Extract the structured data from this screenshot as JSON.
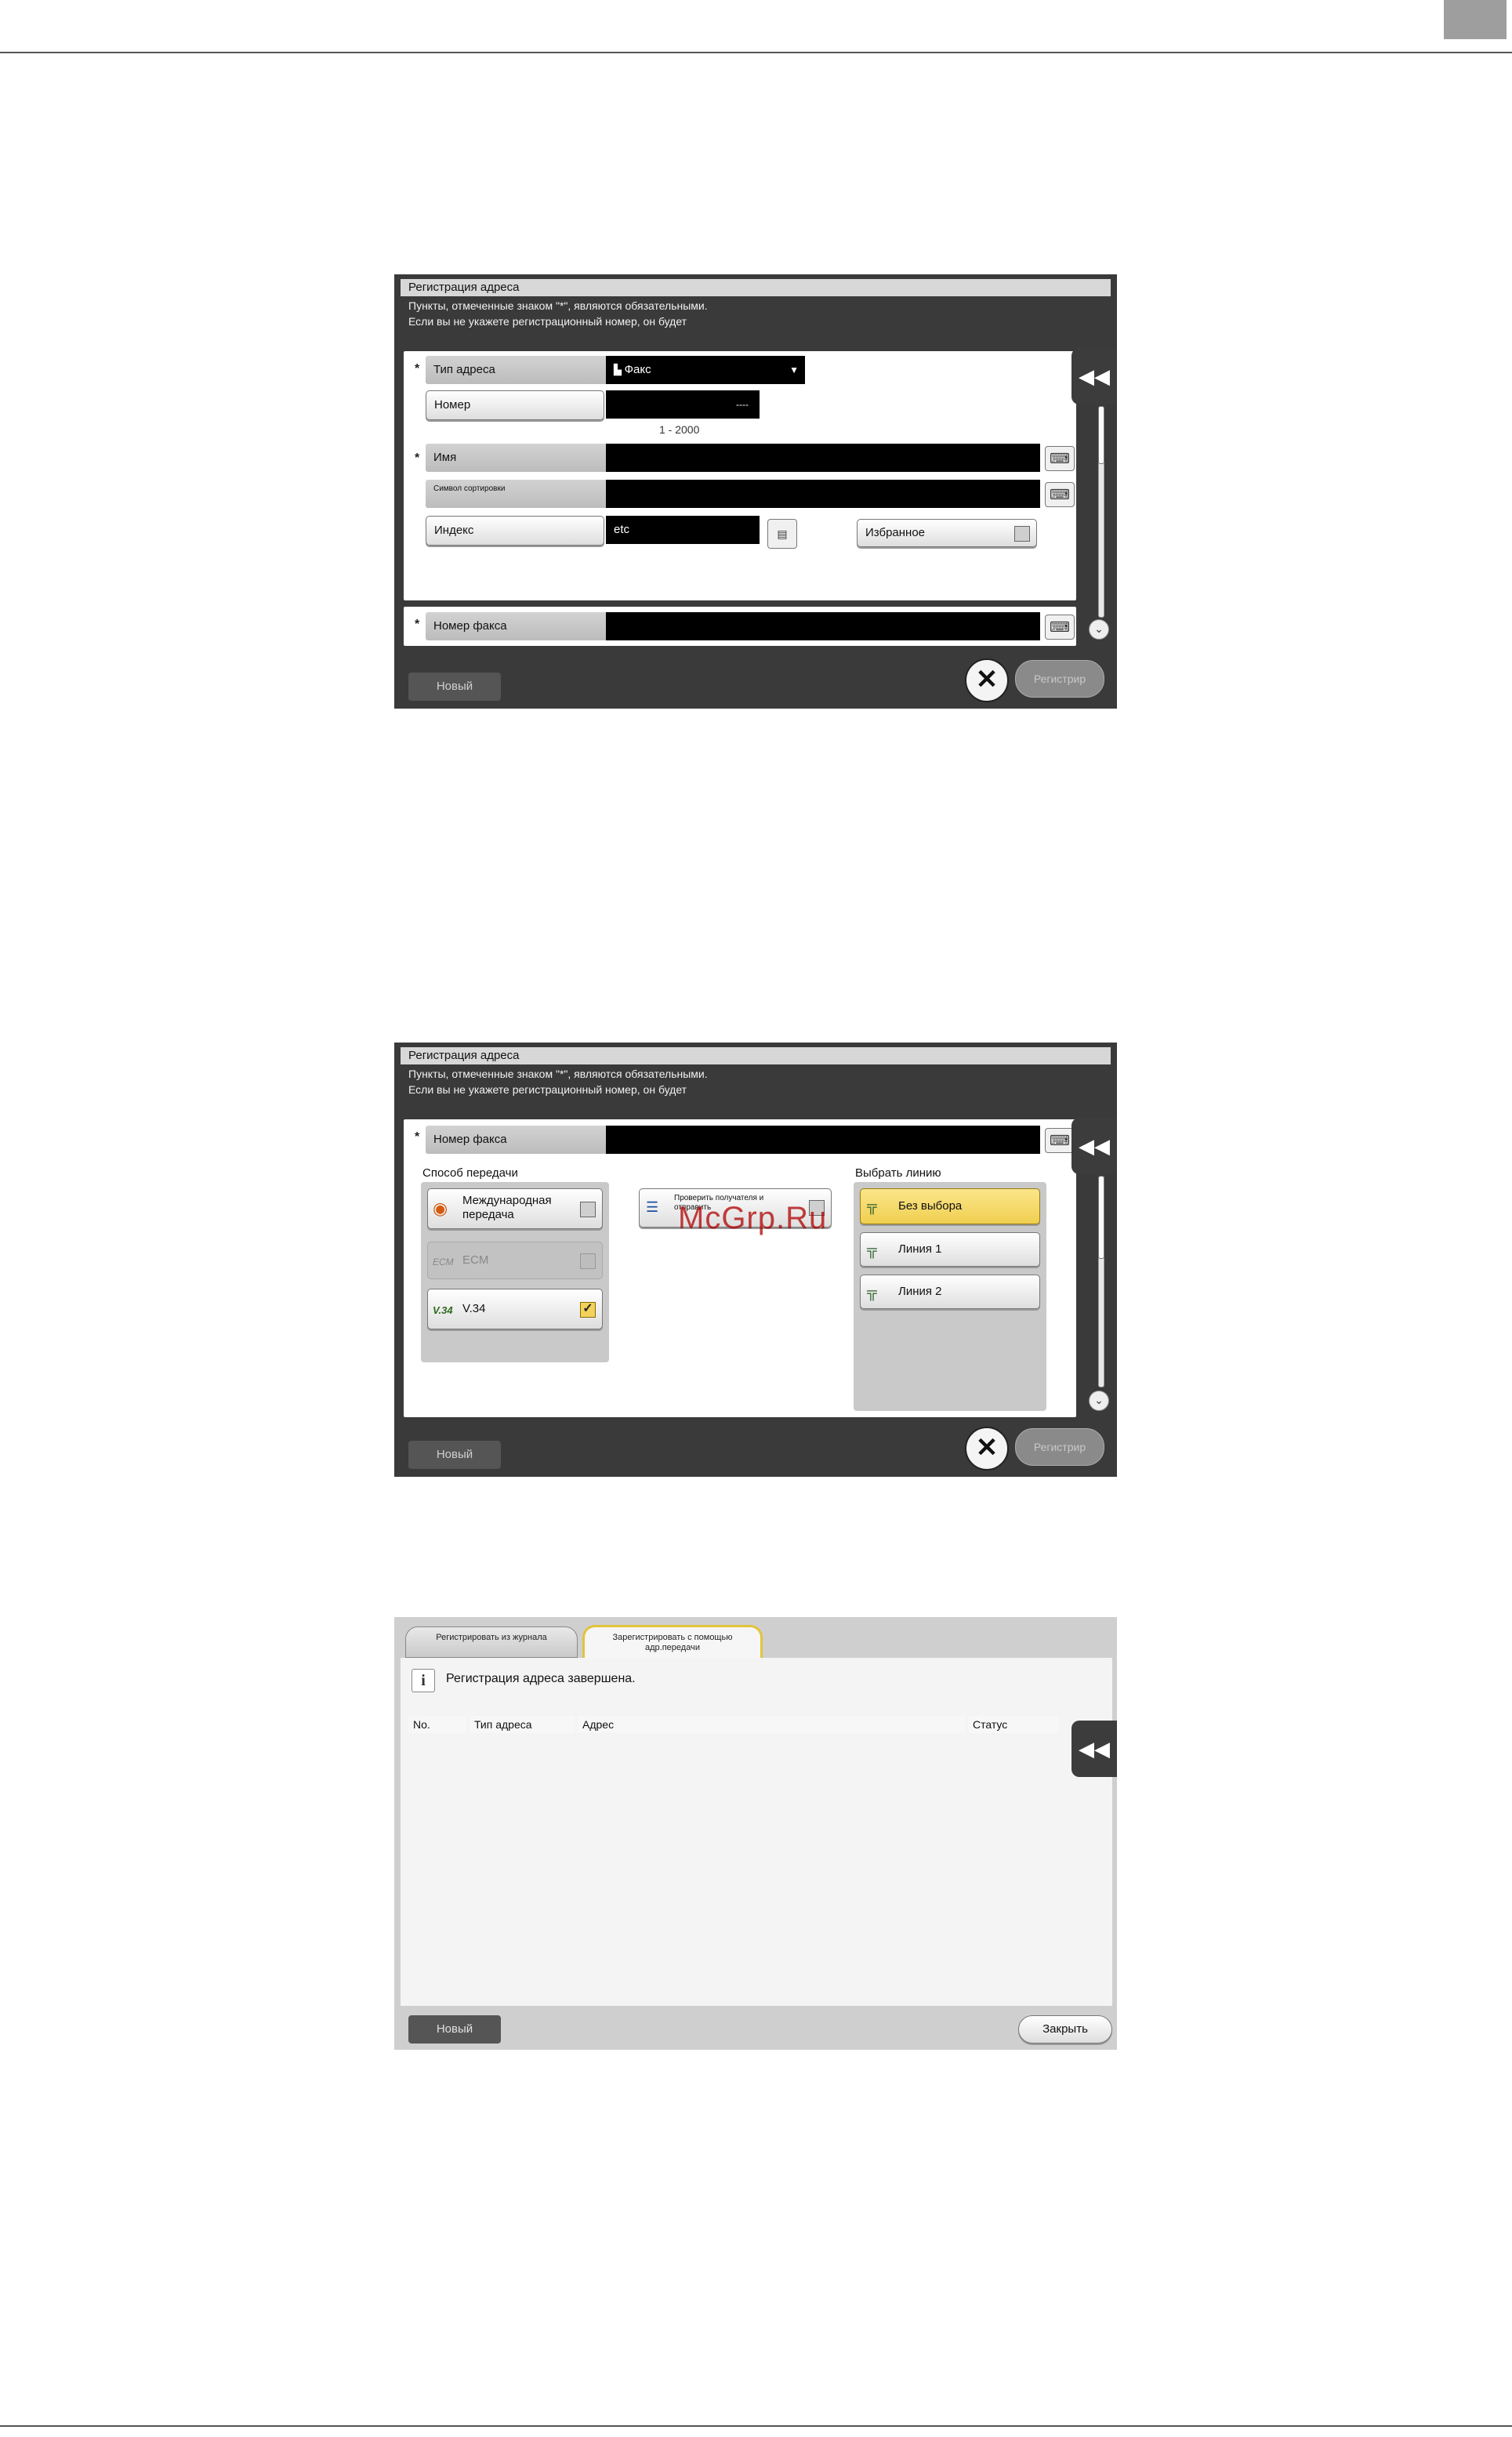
{
  "screens": {
    "title": "Регистрация адреса",
    "note_line1": "Пункты, отмеченные знаком \"*\", являются обязательными.",
    "note_line2": "Если вы не укажете регистрационный номер, он будет",
    "new_button": "Новый",
    "register_button": "Регистрир",
    "close_symbol": "✕",
    "back_symbol": "◀◀",
    "required_mark": "*",
    "keyboard_icon": "keyboard-icon"
  },
  "screen1": {
    "address_type_label": "Тип адреса",
    "address_type_value": "Факс",
    "number_label": "Номер",
    "number_value": "----",
    "number_range": "1 - 2000",
    "name_label": "Имя",
    "sort_label": "Символ сортировки",
    "index_label": "Индекс",
    "index_value": "etc",
    "favorites_label": "Избранное",
    "fax_number_label": "Номер факса"
  },
  "screen2": {
    "fax_number_label": "Номер факса",
    "tx_method_label": "Способ передачи",
    "intl_label": "Международная передача",
    "ecm_label": "ECM",
    "ecm_icon_text": "ECM",
    "v34_label": "V.34",
    "v34_icon_text": "V.34",
    "check_label": "Проверить получателя и отправить",
    "select_line_label": "Выбрать линию",
    "lines": [
      {
        "label": "Без выбора",
        "selected": true
      },
      {
        "label": "Линия 1",
        "selected": false
      },
      {
        "label": "Линия 2",
        "selected": false
      }
    ]
  },
  "screen3": {
    "tab_journal": "Регистрировать из журнала",
    "tab_tx": "Зарегистрировать с помощью адр.передачи",
    "info_icon_text": "i",
    "message": "Регистрация адреса завершена.",
    "columns": [
      "No.",
      "Тип адреса",
      "Адрес",
      "Статус"
    ],
    "new_button": "Новый",
    "close_button": "Закрыть"
  },
  "watermark": "McGrp.Ru",
  "colors": {
    "accent_yellow": "#f2d25a",
    "field_black": "#000000",
    "frame_dark": "#3a3a3a"
  }
}
